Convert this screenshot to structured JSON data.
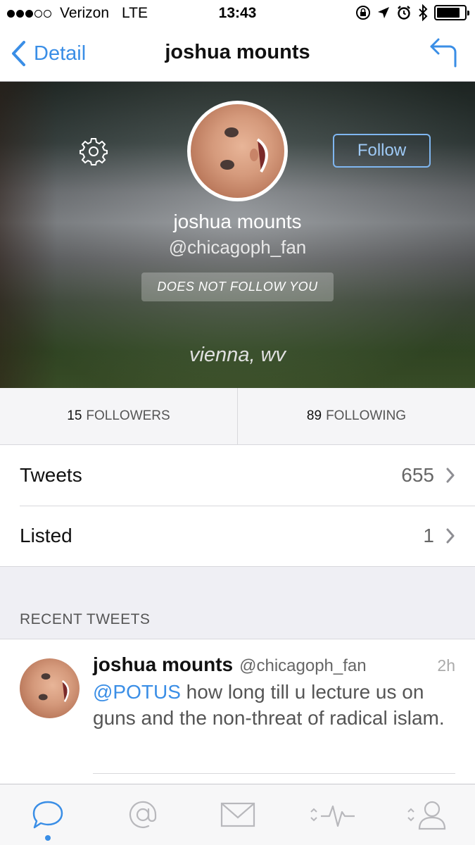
{
  "status_bar": {
    "carrier": "Verizon",
    "network": "LTE",
    "time": "13:43",
    "signal_bars": 3,
    "signal_total": 5,
    "battery_level": 0.85
  },
  "nav": {
    "back_label": "Detail",
    "title": "joshua mounts",
    "icons": {
      "back": "chevron-left-icon",
      "reply": "reply-arrow-icon"
    }
  },
  "profile": {
    "name": "joshua mounts",
    "handle": "@chicagoph_fan",
    "follow_label": "Follow",
    "follow_status": "DOES NOT FOLLOW YOU",
    "location": "vienna, wv"
  },
  "stats": {
    "followers_count": "15",
    "followers_label": "FOLLOWERS",
    "following_count": "89",
    "following_label": "FOLLOWING"
  },
  "rows": [
    {
      "label": "Tweets",
      "count": "655"
    },
    {
      "label": "Listed",
      "count": "1"
    }
  ],
  "recent_tweets_header": "RECENT TWEETS",
  "tweet": {
    "name": "joshua mounts",
    "handle": "@chicagoph_fan",
    "time": "2h",
    "mention": "@POTUS",
    "text": " how long till u lecture us on guns and the non-threat of radical islam."
  },
  "tab_bar": {
    "tabs": [
      "speech-bubble-icon",
      "at-sign-icon",
      "envelope-icon",
      "activity-icon",
      "profile-icon"
    ],
    "active_index": 0,
    "colors": {
      "active": "#3a8ee6",
      "inactive": "#b8b8bc"
    }
  },
  "colors": {
    "accent": "#3a8ee6"
  }
}
